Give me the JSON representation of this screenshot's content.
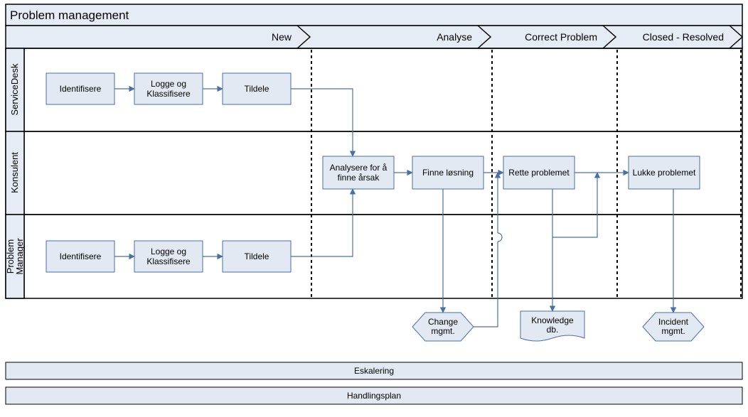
{
  "title": "Problem management",
  "phases": {
    "p1": "New",
    "p2": "Analyse",
    "p3": "Correct Problem",
    "p4": "Closed - Resolved"
  },
  "lanes": {
    "l1": "ServiceDesk",
    "l2": "Konsulent",
    "l3": {
      "a": "Problem",
      "b": "Manager"
    }
  },
  "boxes": {
    "sd_ident": "Identifisere",
    "sd_log1": "Logge og",
    "sd_log2": "Klassifisere",
    "sd_tildele": "Tildele",
    "k_an1": "Analysere for å",
    "k_an2": "finne årsak",
    "k_finne": "Finne løsning",
    "k_rette": "Rette problemet",
    "k_lukke": "Lukke problemet",
    "pm_ident": "Identifisere",
    "pm_log1": "Logge og",
    "pm_log2": "Klassifisere",
    "pm_tildele": "Tildele"
  },
  "outputs": {
    "change1": "Change",
    "change2": "mgmt.",
    "kdb1": "Knowledge",
    "kdb2": "db.",
    "inc1": "Incident",
    "inc2": "mgmt."
  },
  "bars": {
    "b1": "Eskalering",
    "b2": "Handlingsplan"
  }
}
